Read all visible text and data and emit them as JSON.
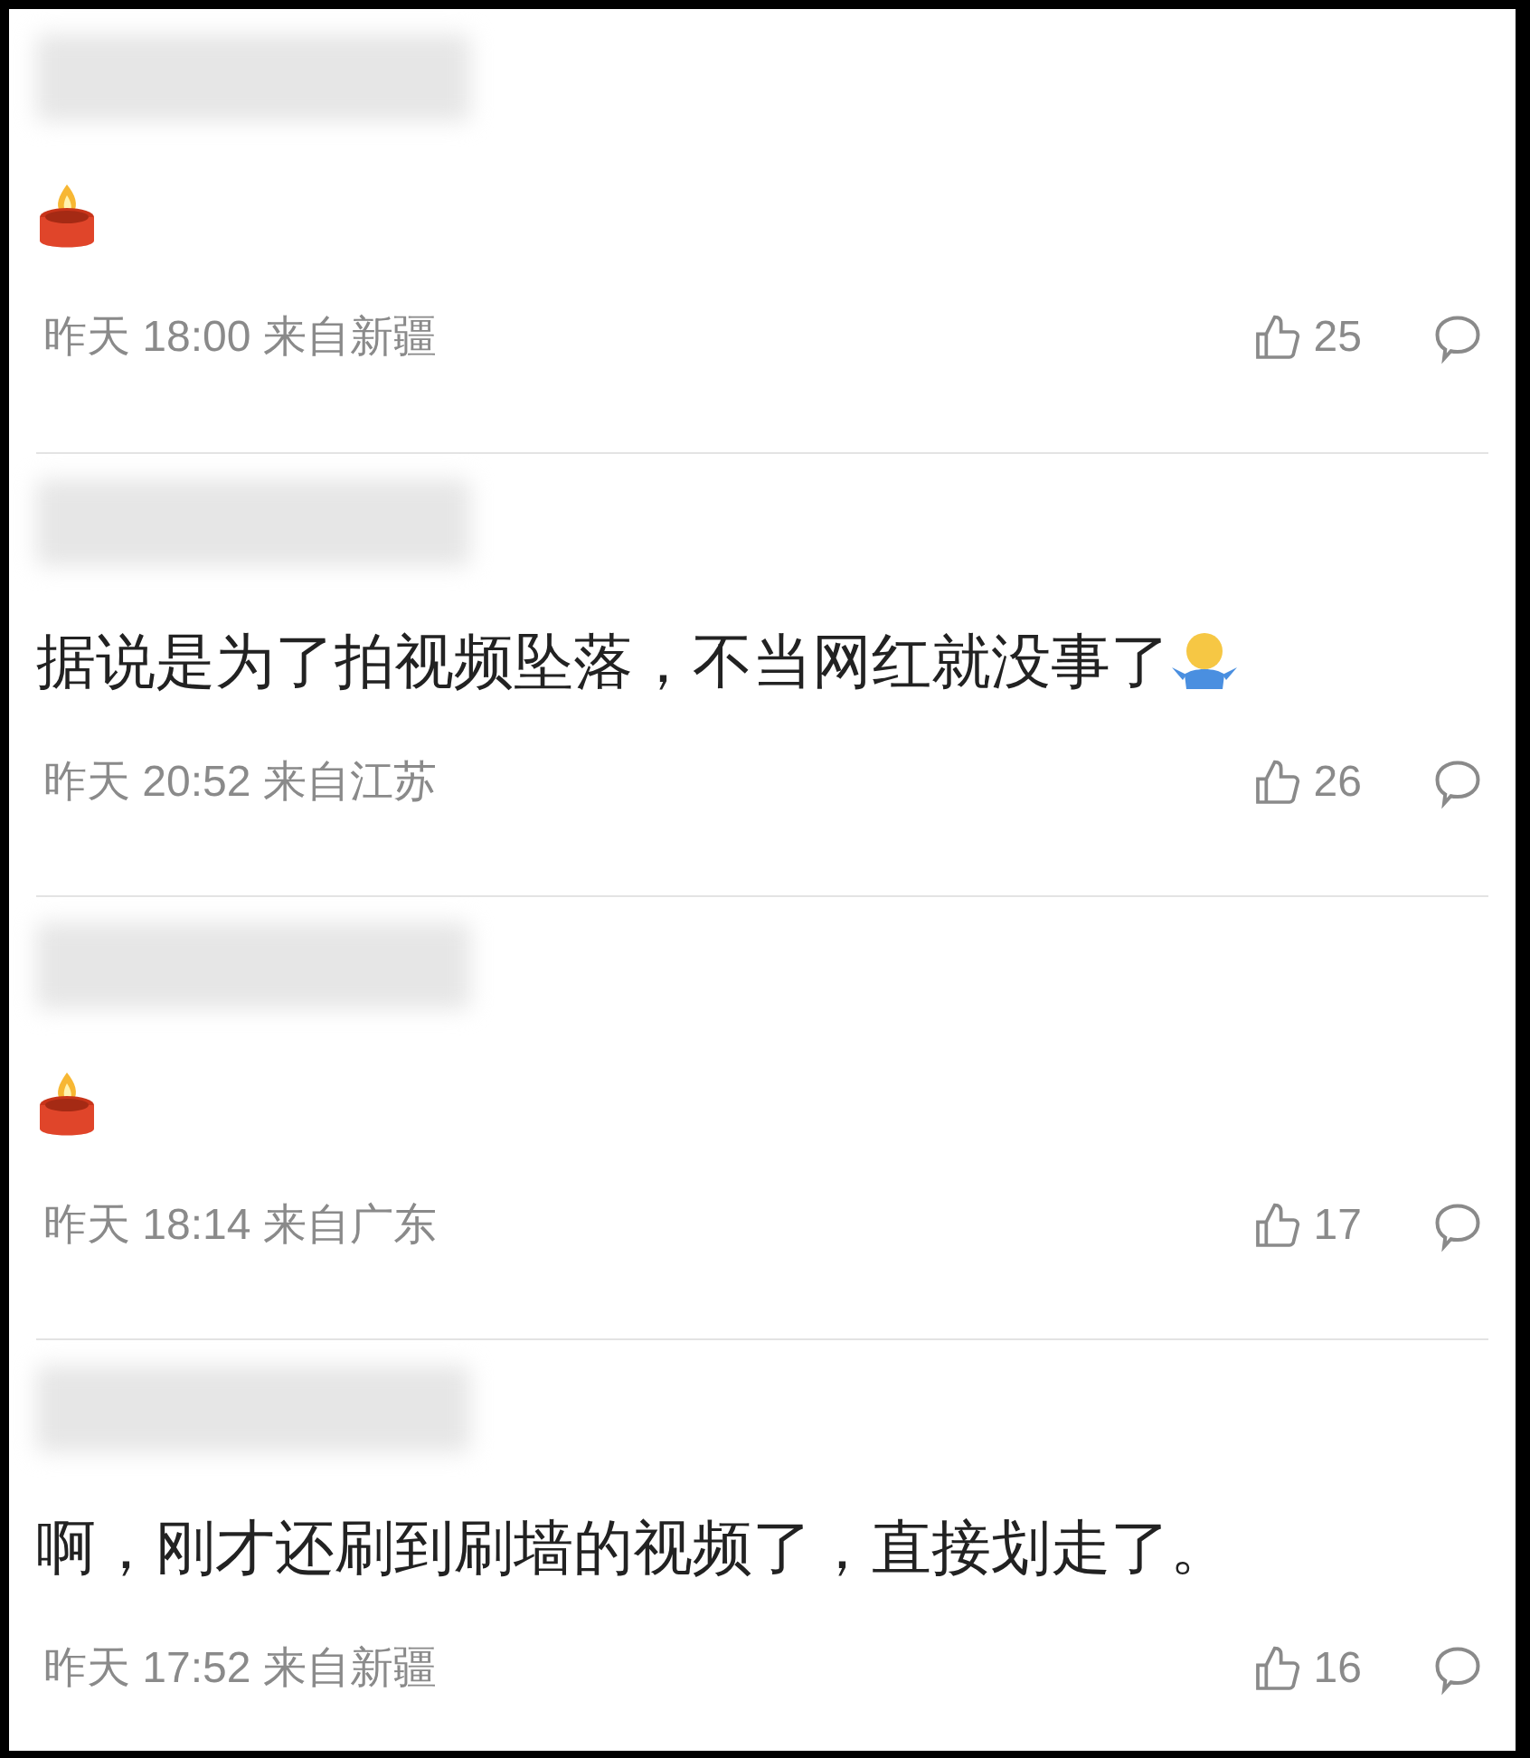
{
  "comments": [
    {
      "emoji": {
        "kind": "candle"
      },
      "time": "昨天 18:00 来自新疆",
      "likes": "25"
    },
    {
      "text": "据说是为了拍视频坠落，不当网红就没事了",
      "emoji": {
        "kind": "shrug"
      },
      "time": "昨天 20:52 来自江苏",
      "likes": "26"
    },
    {
      "emoji": {
        "kind": "candle"
      },
      "time": "昨天 18:14 来自广东",
      "likes": "17"
    },
    {
      "text": "啊，刚才还刷到刷墙的视频了，直接划走了。",
      "time": "昨天 17:52 来自新疆",
      "likes": "16"
    }
  ]
}
